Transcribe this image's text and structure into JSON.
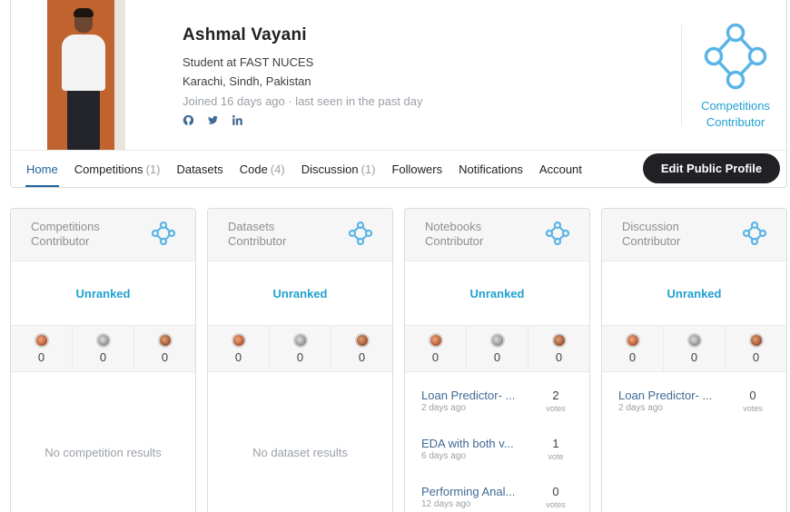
{
  "profile": {
    "name": "Ashmal Vayani",
    "occupation": "Student at FAST NUCES",
    "location": "Karachi, Sindh, Pakistan",
    "joined": "Joined 16 days ago · last seen in the past day",
    "social": [
      "github-icon",
      "twitter-icon",
      "linkedin-icon"
    ],
    "tier_label_line1": "Competitions",
    "tier_label_line2": "Contributor",
    "accent_color": "#20a0d0"
  },
  "tabs": [
    {
      "label": "Home",
      "count": ""
    },
    {
      "label": "Competitions",
      "count": "(1)"
    },
    {
      "label": "Datasets",
      "count": ""
    },
    {
      "label": "Code",
      "count": "(4)"
    },
    {
      "label": "Discussion",
      "count": "(1)"
    },
    {
      "label": "Followers",
      "count": ""
    },
    {
      "label": "Notifications",
      "count": ""
    },
    {
      "label": "Account",
      "count": ""
    }
  ],
  "edit_profile_label": "Edit Public Profile",
  "categories": [
    {
      "title_line1": "Competitions",
      "title_line2": "Contributor",
      "rank": "Unranked",
      "medals": {
        "gold": "0",
        "silver": "0",
        "bronze": "0"
      },
      "empty": "No competition results"
    },
    {
      "title_line1": "Datasets",
      "title_line2": "Contributor",
      "rank": "Unranked",
      "medals": {
        "gold": "0",
        "silver": "0",
        "bronze": "0"
      },
      "empty": "No dataset results"
    },
    {
      "title_line1": "Notebooks",
      "title_line2": "Contributor",
      "rank": "Unranked",
      "medals": {
        "gold": "0",
        "silver": "0",
        "bronze": "0"
      },
      "items": [
        {
          "title": "Loan Predictor- ...",
          "date": "2 days ago",
          "votes": "2",
          "votes_label": "votes"
        },
        {
          "title": "EDA with both v...",
          "date": "6 days ago",
          "votes": "1",
          "votes_label": "vote"
        },
        {
          "title": "Performing Anal...",
          "date": "12 days ago",
          "votes": "0",
          "votes_label": "votes"
        }
      ]
    },
    {
      "title_line1": "Discussion",
      "title_line2": "Contributor",
      "rank": "Unranked",
      "medals": {
        "gold": "0",
        "silver": "0",
        "bronze": "0"
      },
      "items": [
        {
          "title": "Loan Predictor- ...",
          "date": "2 days ago",
          "votes": "0",
          "votes_label": "votes"
        }
      ]
    }
  ]
}
